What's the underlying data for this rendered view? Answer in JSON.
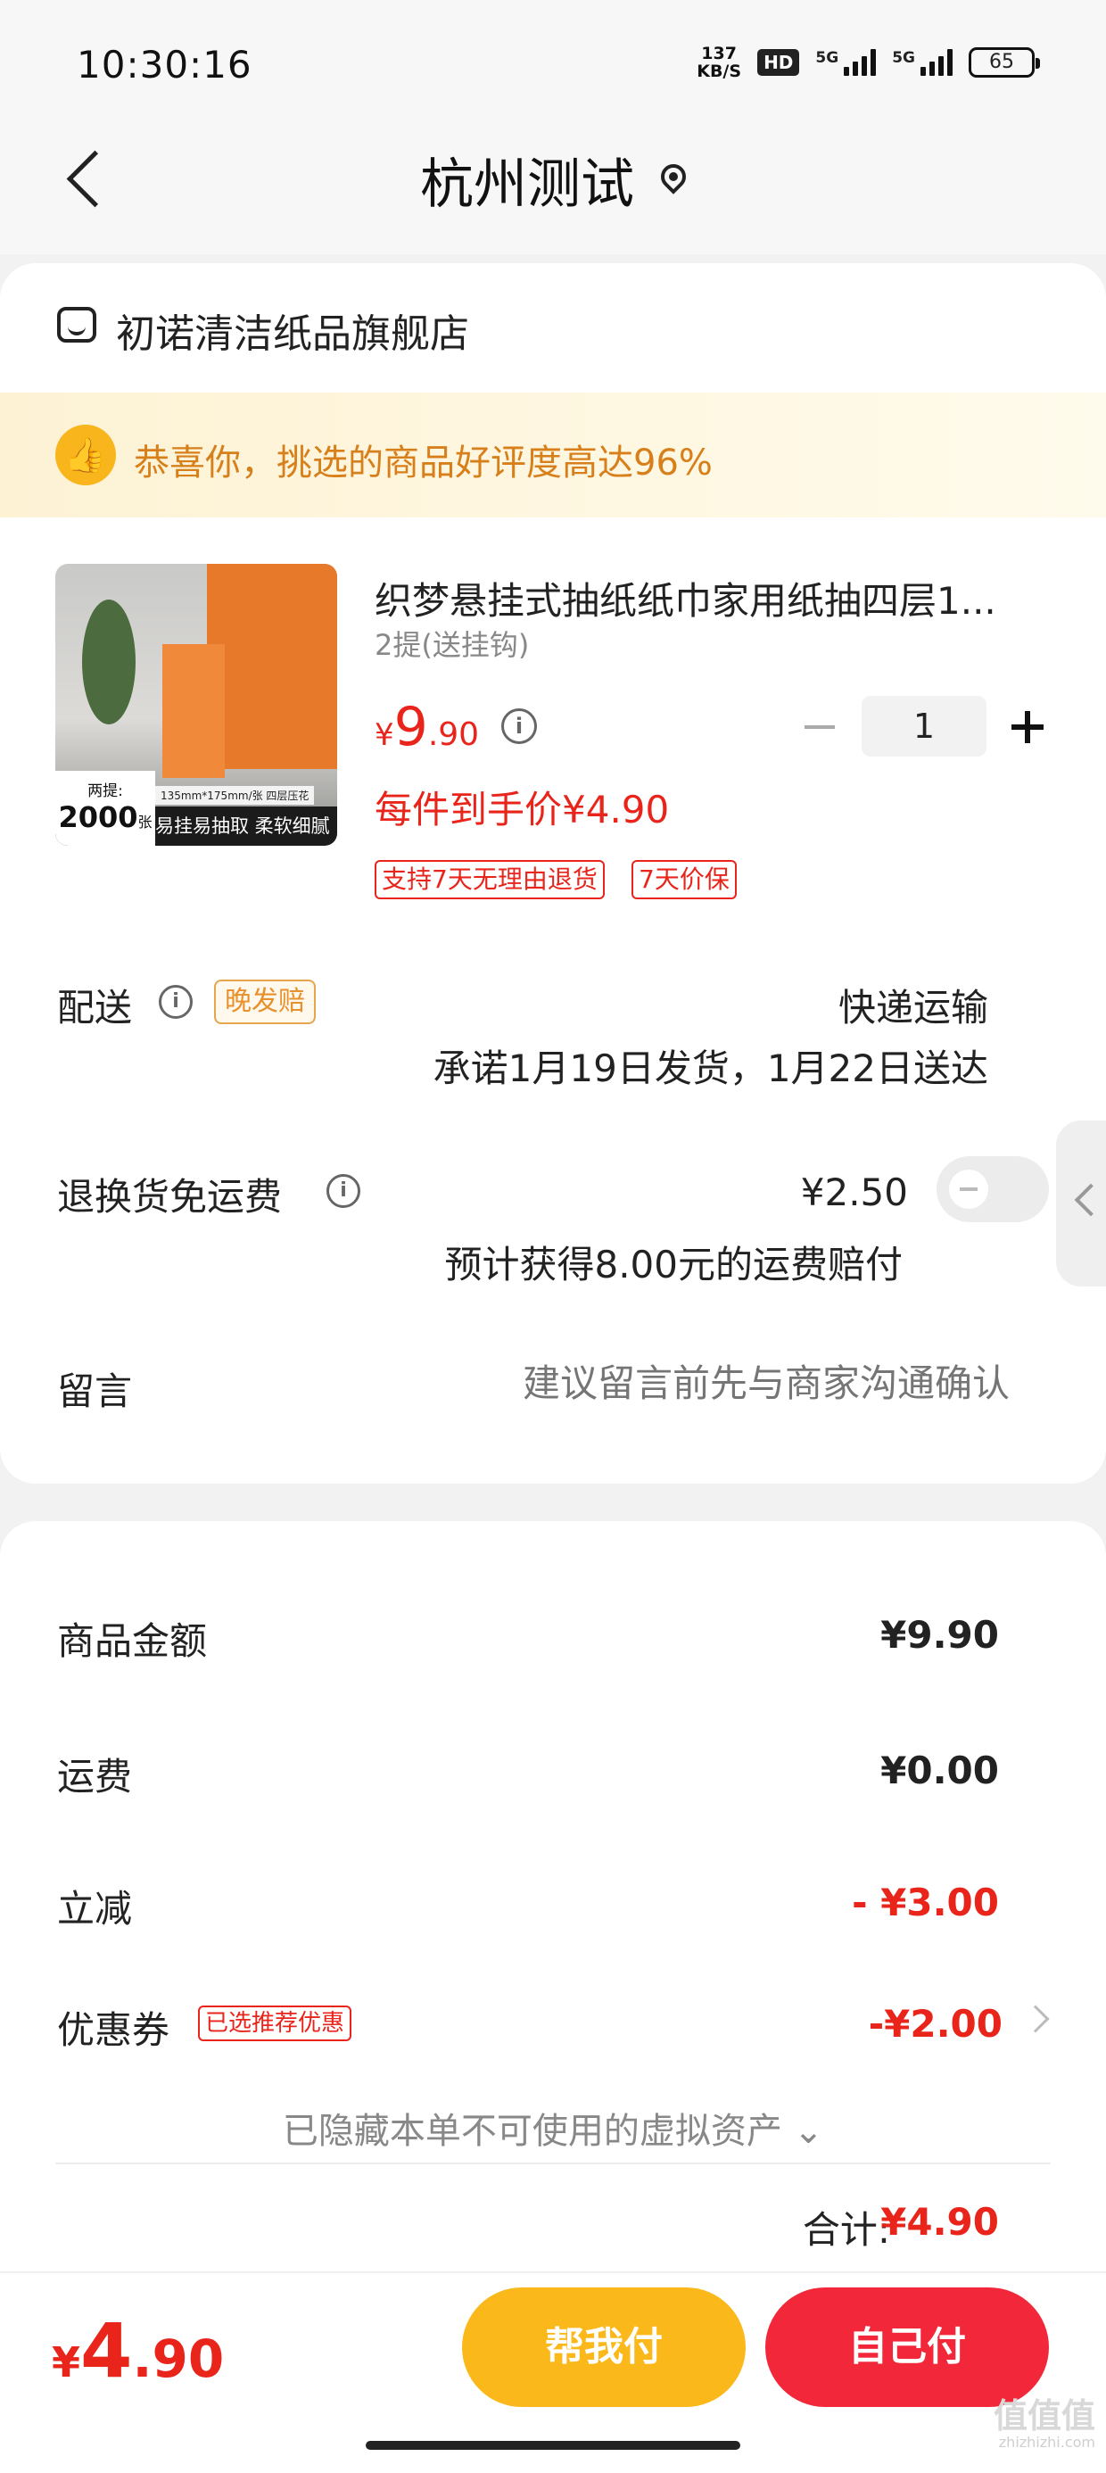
{
  "status_bar": {
    "time": "10:30:16",
    "net_speed_value": "137",
    "net_speed_unit": "KB/S",
    "hd_label": "HD",
    "signal1_label": "5G",
    "signal2_label": "5G",
    "battery": "65"
  },
  "header": {
    "title": "杭州测试",
    "back_icon": "chevron-left-icon",
    "location_icon": "map-pin-icon"
  },
  "store": {
    "name": "初诺清洁纸品旗舰店",
    "icon": "store-icon"
  },
  "review_banner": {
    "text": "恭喜你，挑选的商品好评度高达96%",
    "icon": "thumbs-up-icon"
  },
  "product": {
    "title": "织梦悬挂式抽纸纸巾家用纸抽四层1...",
    "spec": "2提(送挂钩)",
    "price_currency": "¥",
    "price_int": "9",
    "price_dec": ".90",
    "quantity": "1",
    "unit_price": "每件到手价¥4.90",
    "tags": [
      "支持7天无理由退货",
      "7天价保"
    ],
    "image_count_small": "两提:",
    "image_count_big": "2000",
    "image_count_unit": "张",
    "image_size_text": "135mm*175mm/张 四层压花",
    "image_banner": "易挂易抽取 柔软细腻"
  },
  "delivery": {
    "label": "配送",
    "badge": "晚发赔",
    "method": "快递运输",
    "promise": "承诺1月19日发货，1月22日送达"
  },
  "return_shipping": {
    "label": "退换货免运费",
    "price": "¥2.50",
    "compensation": "预计获得8.00元的运费赔付",
    "toggle_on": false
  },
  "message": {
    "label": "留言",
    "placeholder": "建议留言前先与商家沟通确认"
  },
  "summary": {
    "goods_label": "商品金额",
    "goods_value": "¥9.90",
    "shipping_label": "运费",
    "shipping_value": "¥0.00",
    "discount_label": "立减",
    "discount_value": "- ¥3.00",
    "coupon_label": "优惠券",
    "coupon_badge": "已选推荐优惠",
    "coupon_value": "-¥2.00",
    "hidden_assets": "已隐藏本单不可使用的虚拟资产 ⌄",
    "total_label": "合计:",
    "total_value": "¥4.90"
  },
  "bottom_bar": {
    "price_currency": "¥",
    "price_int": "4",
    "price_dec": ".90",
    "help_pay": "帮我付",
    "self_pay": "自己付"
  },
  "watermark": {
    "main": "值值值",
    "sub": "zhizhizhi.com"
  },
  "colors": {
    "accent_red": "#e8241b",
    "help_pay_yellow": "#fbb81a",
    "self_pay_red": "#f2283a",
    "review_orange": "#d7801b"
  }
}
